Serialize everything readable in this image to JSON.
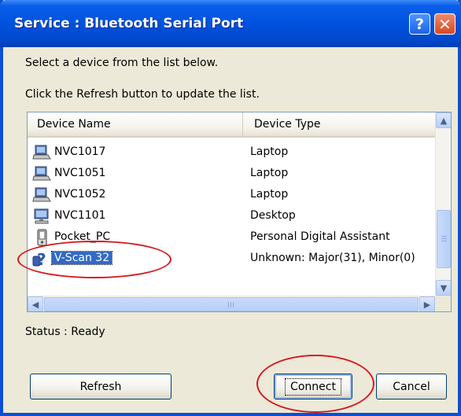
{
  "window": {
    "title": "Service : Bluetooth Serial Port",
    "help_glyph": "?",
    "close_glyph": "✕"
  },
  "instructions": {
    "line1": "Select a device from the list below.",
    "line2": "Click the Refresh button to update the list."
  },
  "device_list": {
    "columns": [
      "Device Name",
      "Device Type"
    ],
    "rows": [
      {
        "name": "NVC1017",
        "type": "Laptop",
        "icon": "laptop-icon"
      },
      {
        "name": "NVC1051",
        "type": "Laptop",
        "icon": "laptop-icon"
      },
      {
        "name": "NVC1052",
        "type": "Laptop",
        "icon": "laptop-icon"
      },
      {
        "name": "NVC1101",
        "type": "Desktop",
        "icon": "desktop-icon"
      },
      {
        "name": "Pocket_PC",
        "type": "Personal Digital Assistant",
        "icon": "pda-icon"
      },
      {
        "name": "V-Scan 32",
        "type": "Unknown: Major(31), Minor(0)",
        "icon": "unknown-device-icon",
        "selected": true
      }
    ]
  },
  "status": "Status : Ready",
  "buttons": {
    "refresh": "Refresh",
    "connect": "Connect",
    "cancel": "Cancel"
  },
  "colors": {
    "titlebar": "#0052df",
    "selection": "#316ac5",
    "annotation": "#d71920"
  }
}
